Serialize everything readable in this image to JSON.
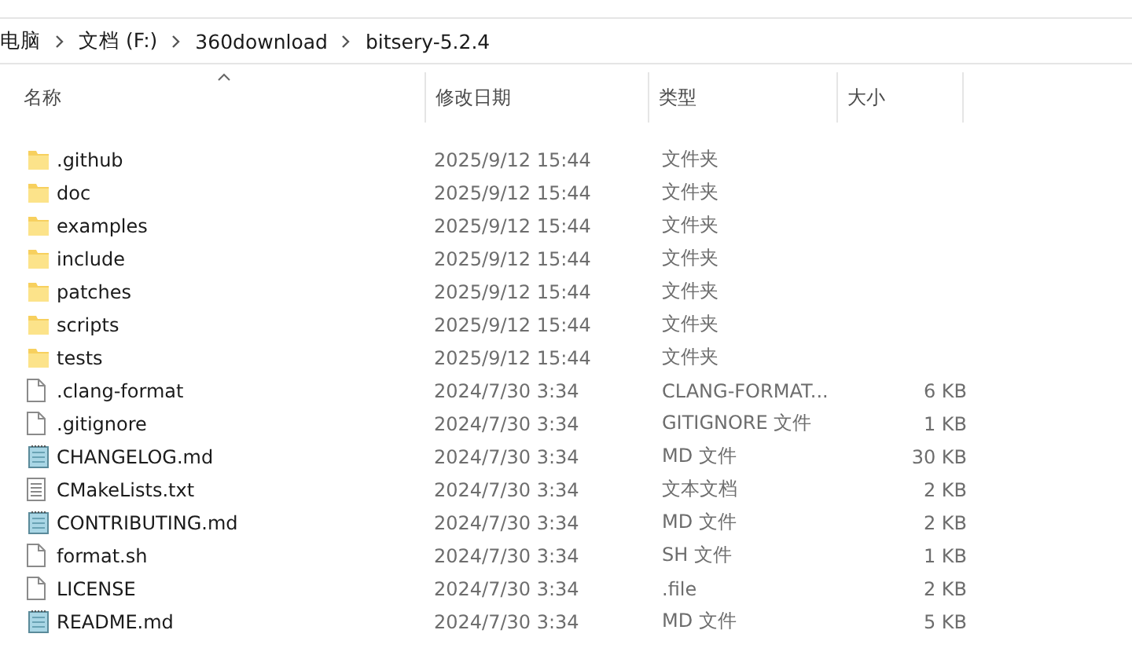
{
  "breadcrumb": [
    "电脑",
    "文档 (F:)",
    "360download",
    "bitsery-5.2.4"
  ],
  "columns": [
    {
      "label": "名称",
      "sorted": true
    },
    {
      "label": "修改日期",
      "sorted": false
    },
    {
      "label": "类型",
      "sorted": false
    },
    {
      "label": "大小",
      "sorted": false
    }
  ],
  "files": [
    {
      "kind": "folder",
      "name": ".github",
      "date": "2025/9/12 15:44",
      "type": "文件夹"
    },
    {
      "kind": "folder",
      "name": "doc",
      "date": "2025/9/12 15:44",
      "type": "文件夹"
    },
    {
      "kind": "folder",
      "name": "examples",
      "date": "2025/9/12 15:44",
      "type": "文件夹"
    },
    {
      "kind": "folder",
      "name": "include",
      "date": "2025/9/12 15:44",
      "type": "文件夹"
    },
    {
      "kind": "folder",
      "name": "patches",
      "date": "2025/9/12 15:44",
      "type": "文件夹"
    },
    {
      "kind": "folder",
      "name": "scripts",
      "date": "2025/9/12 15:44",
      "type": "文件夹"
    },
    {
      "kind": "folder",
      "name": "tests",
      "date": "2025/9/12 15:44",
      "type": "文件夹"
    },
    {
      "kind": "blank",
      "name": ".clang-format",
      "date": "2024/7/30 3:34",
      "type": "CLANG-FORMAT...",
      "size": "6 KB"
    },
    {
      "kind": "blank",
      "name": ".gitignore",
      "date": "2024/7/30 3:34",
      "type": "GITIGNORE 文件",
      "size": "1 KB"
    },
    {
      "kind": "notepad",
      "name": "CHANGELOG.md",
      "date": "2024/7/30 3:34",
      "type": "MD 文件",
      "size": "30 KB"
    },
    {
      "kind": "text",
      "name": "CMakeLists.txt",
      "date": "2024/7/30 3:34",
      "type": "文本文档",
      "size": "2 KB"
    },
    {
      "kind": "notepad",
      "name": "CONTRIBUTING.md",
      "date": "2024/7/30 3:34",
      "type": "MD 文件",
      "size": "2 KB"
    },
    {
      "kind": "blank",
      "name": "format.sh",
      "date": "2024/7/30 3:34",
      "type": "SH 文件",
      "size": "1 KB"
    },
    {
      "kind": "blank",
      "name": "LICENSE",
      "date": "2024/7/30 3:34",
      "type": ".file",
      "size": "2 KB"
    },
    {
      "kind": "notepad",
      "name": "README.md",
      "date": "2024/7/30 3:34",
      "type": "MD 文件",
      "size": "5 KB"
    }
  ]
}
